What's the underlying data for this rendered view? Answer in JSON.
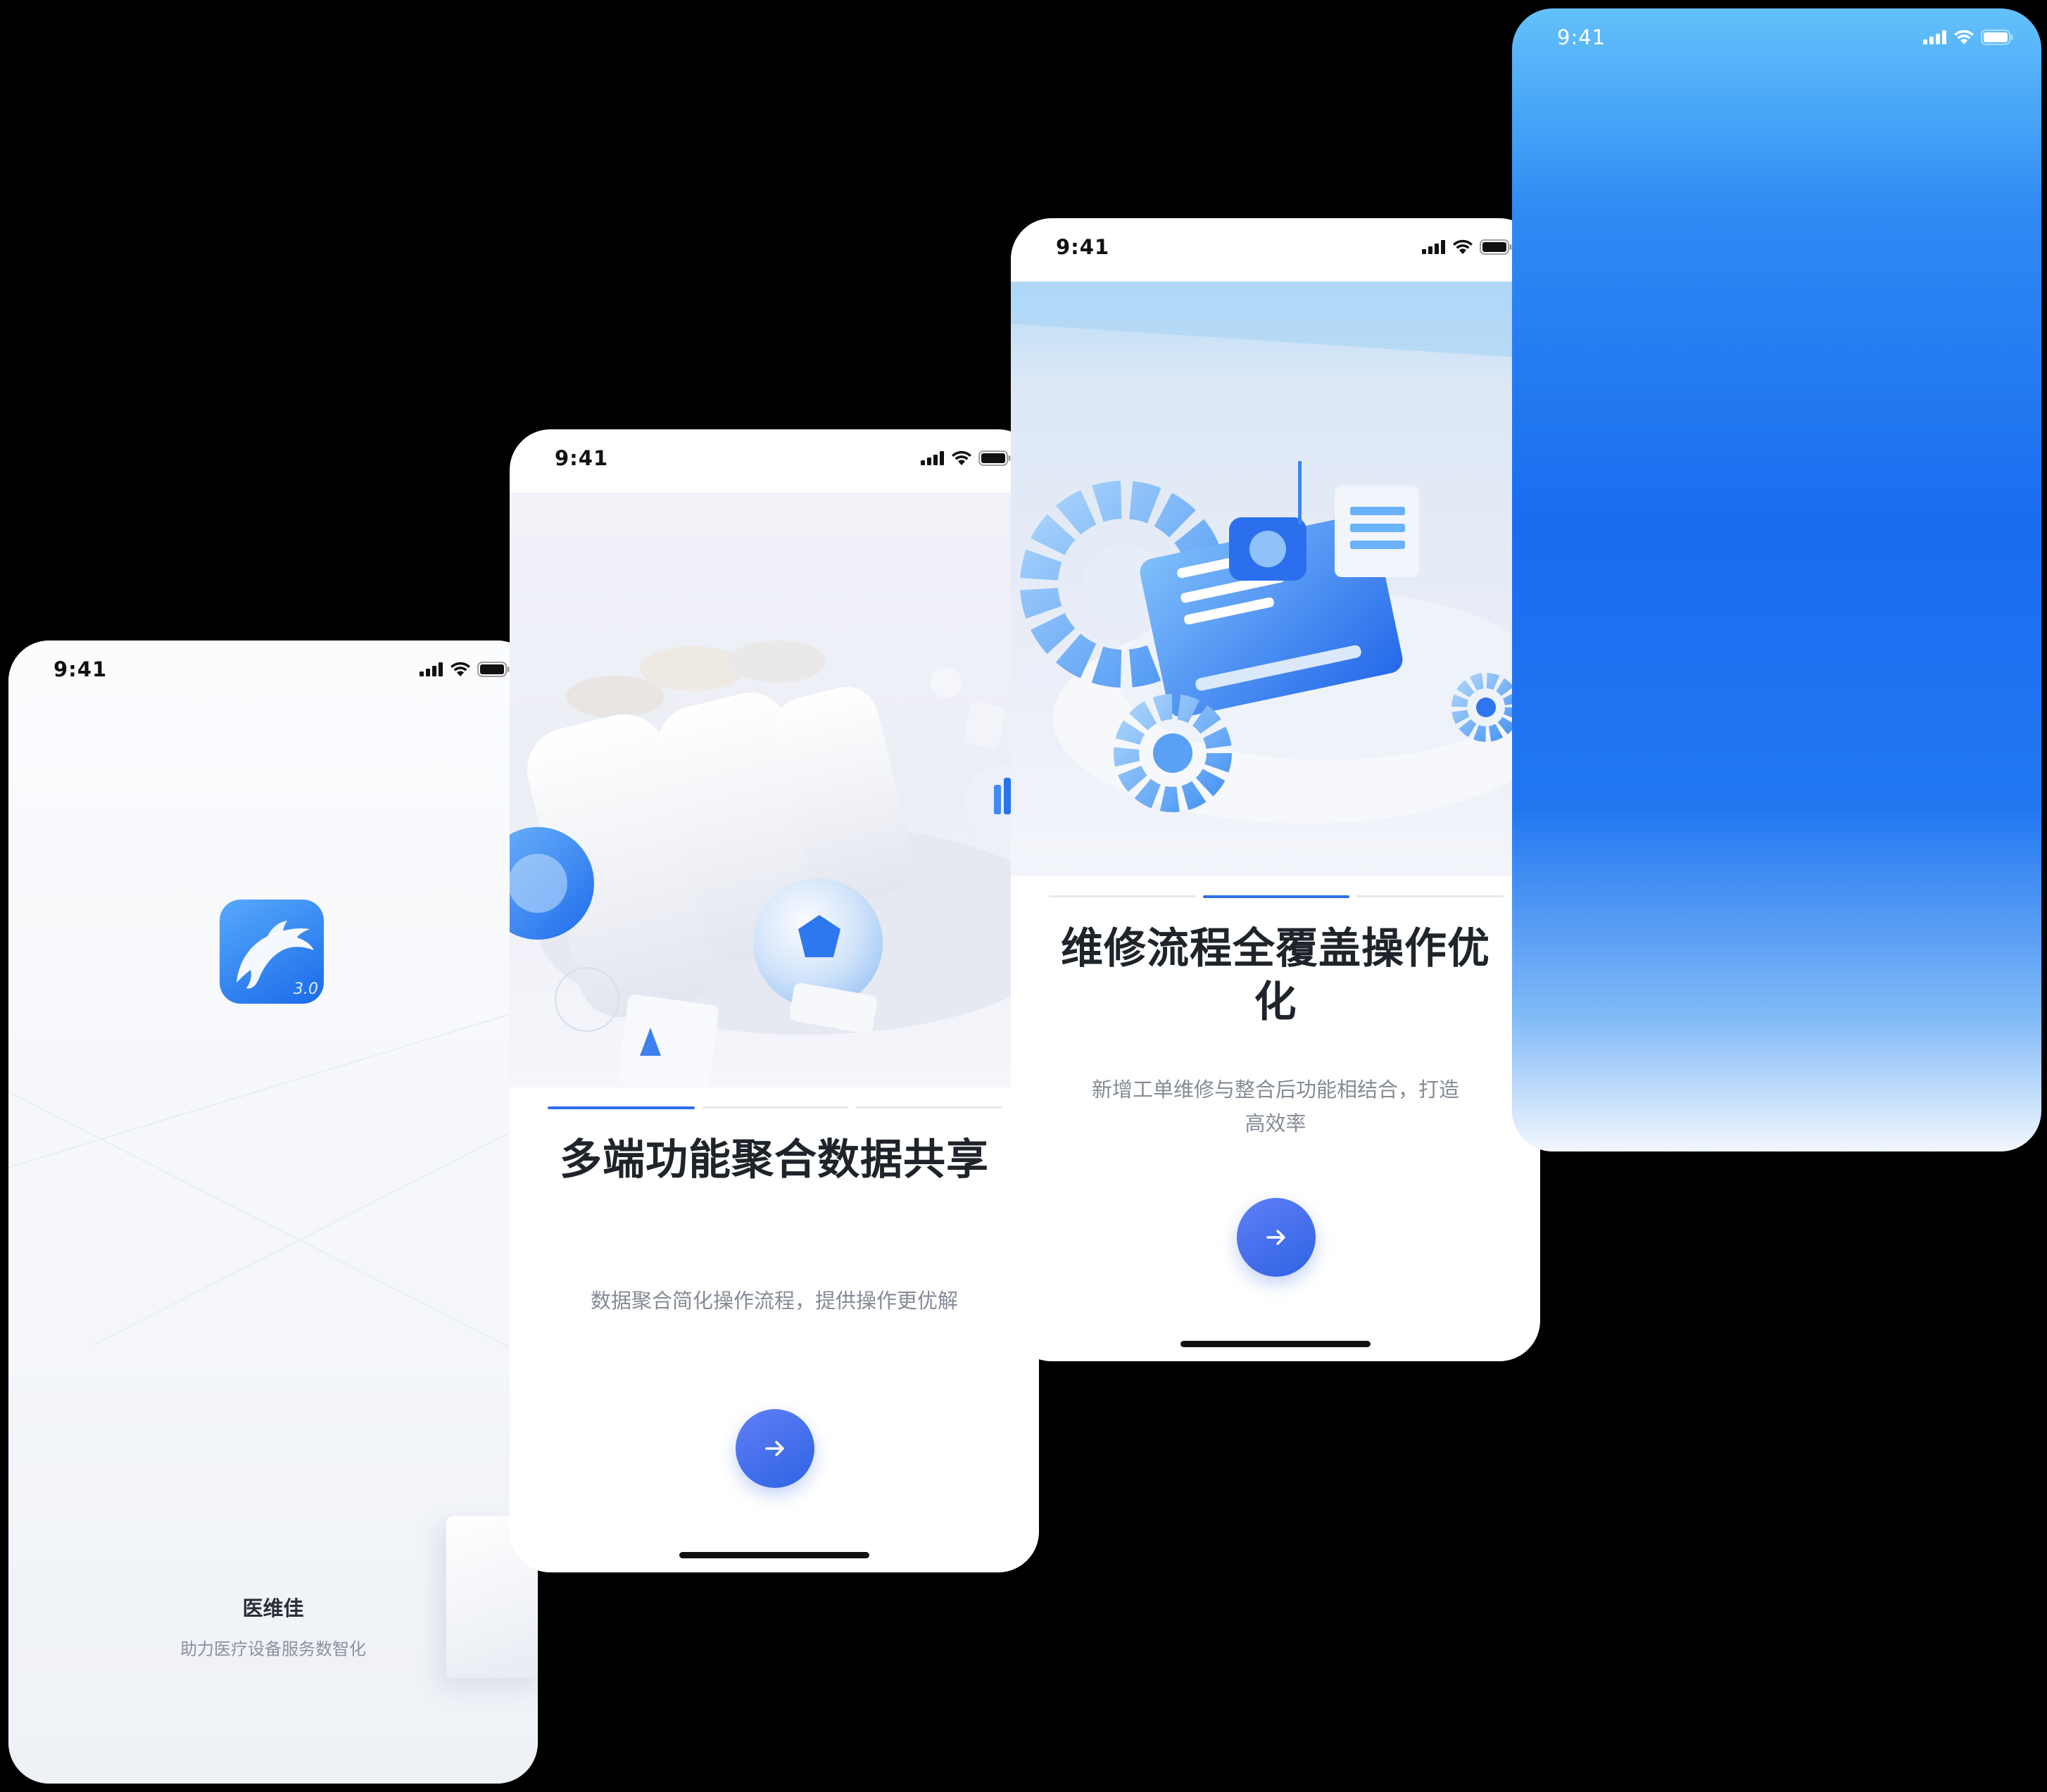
{
  "status_bar": {
    "time": "9:41"
  },
  "splash": {
    "app_version": "3.0",
    "app_name": "医维佳",
    "slogan": "助力医疗设备服务数智化"
  },
  "onboarding": [
    {
      "title": "多端功能聚合数据共享",
      "description": "数据聚合简化操作流程，提供操作更优解",
      "active_step": 1,
      "step_count": 3
    },
    {
      "title": "维修流程全覆盖操作优化",
      "description": "新增工单维修与整合后功能相结合，打造高效率",
      "active_step": 2,
      "step_count": 3
    }
  ],
  "icons": {
    "signal": "signal-icon",
    "wifi": "wifi-icon",
    "battery": "battery-icon",
    "next": "arrow-right-icon",
    "app": "dolphin-icon"
  },
  "colors": {
    "accent": "#2f63e3",
    "title": "#1f242b",
    "description": "#858b96",
    "splash_bg": "#f4f6fa",
    "gradient_top": "#63c1fb",
    "gradient_mid": "#1a6cef"
  }
}
